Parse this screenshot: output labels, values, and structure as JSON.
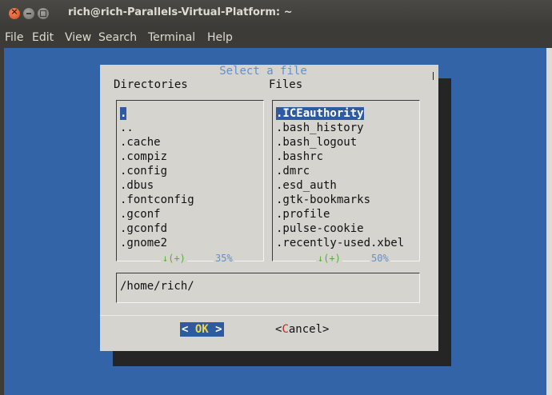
{
  "window": {
    "title": "rich@rich-Parallels-Virtual-Platform: ~"
  },
  "menubar": [
    "File",
    "Edit",
    "View",
    "Search",
    "Terminal",
    "Help"
  ],
  "dialog": {
    "title": "Select a file",
    "dirs_header": "Directories",
    "files_header": "Files",
    "directories": [
      ".",
      "..",
      ".cache",
      ".compiz",
      ".config",
      ".dbus",
      ".fontconfig",
      ".gconf",
      ".gconfd",
      ".gnome2"
    ],
    "files": [
      ".ICEauthority",
      ".bash_history",
      ".bash_logout",
      ".bashrc",
      ".dmrc",
      ".esd_auth",
      ".gtk-bookmarks",
      ".profile",
      ".pulse-cookie",
      ".recently-used.xbel"
    ],
    "dir_scroll": {
      "indicator": "↓(+)",
      "percent": "35%"
    },
    "file_scroll": {
      "indicator": "↓(+)",
      "percent": "50%"
    },
    "path": "/home/rich/",
    "ok": {
      "left": "<",
      "label": "OK",
      "right": ">"
    },
    "cancel": {
      "open": "<",
      "hotkey": "C",
      "rest": "ancel",
      "close": ">"
    }
  }
}
